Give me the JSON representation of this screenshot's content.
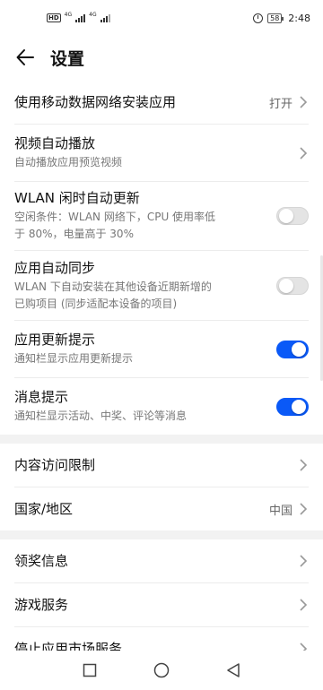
{
  "status_bar": {
    "network_a": "4G",
    "network_b": "4G",
    "battery": "58",
    "time": "2:48"
  },
  "header": {
    "title": "设置"
  },
  "settings": {
    "mobile_data_install": {
      "label": "使用移动数据网络安装应用",
      "value": "打开"
    },
    "video_autoplay": {
      "label": "视频自动播放",
      "desc": "自动播放应用预览视频"
    },
    "wlan_idle_update": {
      "label": "WLAN 闲时自动更新",
      "desc_line1": "空闲条件：WLAN 网络下，CPU 使用率低",
      "desc_line2": "于 80%，电量高于 30%",
      "enabled": false
    },
    "app_auto_sync": {
      "label": "应用自动同步",
      "desc_line1": "WLAN 下自动安装在其他设备近期新增的",
      "desc_line2": "已购项目 (同步适配本设备的项目)",
      "enabled": false
    },
    "update_notice": {
      "label": "应用更新提示",
      "desc": "通知栏显示应用更新提示",
      "enabled": true
    },
    "message_notice": {
      "label": "消息提示",
      "desc": "通知栏显示活动、中奖、评论等消息",
      "enabled": true
    },
    "content_restriction": {
      "label": "内容访问限制"
    },
    "country_region": {
      "label": "国家/地区",
      "value": "中国"
    },
    "prize_info": {
      "label": "领奖信息"
    },
    "game_service": {
      "label": "游戏服务"
    },
    "stop_service": {
      "label": "停止应用市场服务"
    }
  },
  "colors": {
    "accent": "#0a59f7",
    "toggle_off": "#e4e4e4"
  },
  "icons": {
    "back": "arrow-left-icon",
    "chevron": "chevron-right-icon",
    "nav_recent": "square-icon",
    "nav_home": "circle-icon",
    "nav_back": "triangle-left-icon"
  }
}
